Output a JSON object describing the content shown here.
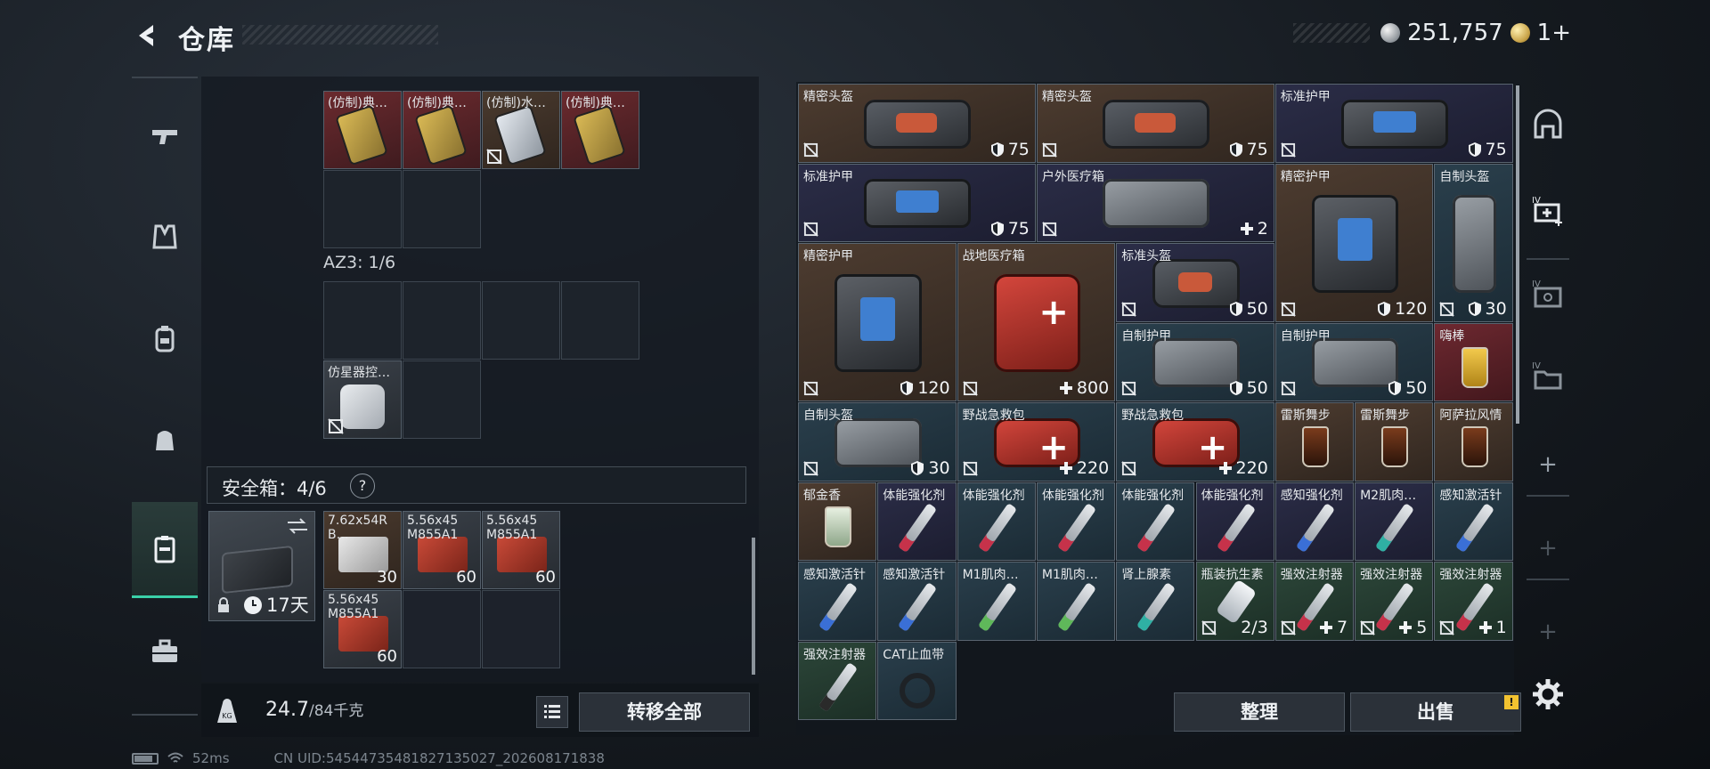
{
  "header": {
    "title": "仓库",
    "currency_amount": "251,757",
    "premium_label": "1+"
  },
  "backpack": {
    "top_items": [
      {
        "name": "(仿制)典…",
        "bg": "red",
        "art": "gold-card"
      },
      {
        "name": "(仿制)典…",
        "bg": "red",
        "art": "gold-card"
      },
      {
        "name": "(仿制)水…",
        "bg": "brown",
        "art": "silver-card"
      },
      {
        "name": "(仿制)典…",
        "bg": "red",
        "art": "gold-card"
      }
    ],
    "az_label": "AZ3: 1/6",
    "az_item": {
      "name": "仿星器控…"
    }
  },
  "safe_box": {
    "label": "安全箱：4/6",
    "help": "?",
    "days": "17天",
    "ammo": [
      {
        "name_line1": "7.62x54R",
        "name_line2": "B…",
        "count": "30",
        "style": "white"
      },
      {
        "name_line1": "5.56x45",
        "name_line2": "M855A1",
        "count": "60",
        "style": "red"
      },
      {
        "name_line1": "5.56x45",
        "name_line2": "M855A1",
        "count": "60",
        "style": "red"
      },
      {
        "name_line1": "5.56x45",
        "name_line2": "M855A1",
        "count": "60",
        "style": "red"
      }
    ]
  },
  "weight": {
    "current": "24.7",
    "max": "/84千克"
  },
  "buttons": {
    "transfer_all": "转移全部",
    "sort": "整理",
    "sell": "出售",
    "sell_alert": "!"
  },
  "warehouse": {
    "items": [
      {
        "name": "精密头盔",
        "value": "75",
        "value_icon": "shield",
        "color": "brown",
        "art": "helmet"
      },
      {
        "name": "精密头盔",
        "value": "75",
        "value_icon": "shield",
        "color": "brown",
        "art": "helmet"
      },
      {
        "name": "标准护甲",
        "value": "75",
        "value_icon": "shield",
        "color": "navy",
        "art": "vest"
      },
      {
        "name": "标准护甲",
        "value": "75",
        "value_icon": "shield",
        "color": "navy",
        "art": "vest"
      },
      {
        "name": "户外医疗箱",
        "value": "2",
        "value_icon": "plus",
        "color": "navy",
        "art": "pack"
      },
      {
        "name": "精密护甲",
        "value": "120",
        "value_icon": "shield",
        "color": "brown",
        "art": "vest"
      },
      {
        "name": "自制头盔",
        "value": "30",
        "value_icon": "shield",
        "color": "teal",
        "art": "pack"
      },
      {
        "name": "精密护甲",
        "value": "120",
        "value_icon": "shield",
        "color": "brown",
        "art": "vest"
      },
      {
        "name": "战地医疗箱",
        "value": "800",
        "value_icon": "plus",
        "color": "brown",
        "art": "medkit"
      },
      {
        "name": "标准头盔",
        "value": "50",
        "value_icon": "shield",
        "color": "navy",
        "art": "helmet"
      },
      {
        "name": "自制护甲",
        "value": "50",
        "value_icon": "shield",
        "color": "teal",
        "art": "pack"
      },
      {
        "name": "自制护甲",
        "value": "50",
        "value_icon": "shield",
        "color": "teal",
        "art": "pack"
      },
      {
        "name": "嗨棒",
        "value": "",
        "value_icon": "",
        "color": "red",
        "art": "drink-yellow"
      },
      {
        "name": "自制头盔",
        "value": "30",
        "value_icon": "shield",
        "color": "teal",
        "art": "pack"
      },
      {
        "name": "野战急救包",
        "value": "220",
        "value_icon": "plus",
        "color": "teal",
        "art": "medkit"
      },
      {
        "name": "野战急救包",
        "value": "220",
        "value_icon": "plus",
        "color": "teal",
        "art": "medkit"
      },
      {
        "name": "雷斯舞步",
        "value": "",
        "value_icon": "",
        "color": "brown",
        "art": "drink"
      },
      {
        "name": "雷斯舞步",
        "value": "",
        "value_icon": "",
        "color": "brown",
        "art": "drink"
      },
      {
        "name": "阿萨拉风情",
        "value": "",
        "value_icon": "",
        "color": "brown",
        "art": "drink"
      },
      {
        "name": "郁金香",
        "value": "",
        "value_icon": "",
        "color": "brown",
        "art": "drink-clear"
      },
      {
        "name": "体能强化剂",
        "value": "",
        "value_icon": "",
        "color": "navy",
        "art": "syringe-red"
      },
      {
        "name": "体能强化剂",
        "value": "",
        "value_icon": "",
        "color": "teal",
        "art": "syringe-red"
      },
      {
        "name": "体能强化剂",
        "value": "",
        "value_icon": "",
        "color": "teal",
        "art": "syringe-red"
      },
      {
        "name": "体能强化剂",
        "value": "",
        "value_icon": "",
        "color": "teal",
        "art": "syringe-red"
      },
      {
        "name": "体能强化剂",
        "value": "",
        "value_icon": "",
        "color": "navy",
        "art": "syringe-red"
      },
      {
        "name": "感知强化剂",
        "value": "",
        "value_icon": "",
        "color": "navy",
        "art": "syringe-blue"
      },
      {
        "name": "M2肌肉…",
        "value": "",
        "value_icon": "",
        "color": "navy",
        "art": "syringe-teal"
      },
      {
        "name": "感知激活针",
        "value": "",
        "value_icon": "",
        "color": "teal",
        "art": "syringe-blue"
      },
      {
        "name": "感知激活针",
        "value": "",
        "value_icon": "",
        "color": "teal",
        "art": "syringe-blue"
      },
      {
        "name": "感知激活针",
        "value": "",
        "value_icon": "",
        "color": "teal",
        "art": "syringe-blue"
      },
      {
        "name": "M1肌肉…",
        "value": "",
        "value_icon": "",
        "color": "teal",
        "art": "syringe-green"
      },
      {
        "name": "M1肌肉…",
        "value": "",
        "value_icon": "",
        "color": "teal",
        "art": "syringe-green"
      },
      {
        "name": "肾上腺素",
        "value": "",
        "value_icon": "",
        "color": "teal",
        "art": "syringe-teal"
      },
      {
        "name": "瓶装抗生素",
        "value": "2/3",
        "value_icon": "",
        "color": "green",
        "art": "bottle"
      },
      {
        "name": "强效注射器",
        "value": "7",
        "value_icon": "plus",
        "color": "green",
        "art": "syringe-red"
      },
      {
        "name": "强效注射器",
        "value": "5",
        "value_icon": "plus",
        "color": "green",
        "art": "syringe-red"
      },
      {
        "name": "强效注射器",
        "value": "1",
        "value_icon": "plus",
        "color": "green",
        "art": "syringe-red"
      },
      {
        "name": "强效注射器",
        "value": "",
        "value_icon": "",
        "color": "green",
        "art": "syringe-black"
      },
      {
        "name": "CAT止血带",
        "value": "",
        "value_icon": "",
        "color": "teal",
        "art": "tourniquet"
      }
    ]
  },
  "status": {
    "ping": "52ms",
    "uid": "CN UID:5454473548182713502​7_202608171838"
  },
  "colors": {
    "accent": "#3ad0a8",
    "brown": "#4d3c30",
    "navy": "#2b2d47",
    "teal": "#2a3f4c",
    "red": "#6d2830",
    "green": "#2c4639"
  }
}
